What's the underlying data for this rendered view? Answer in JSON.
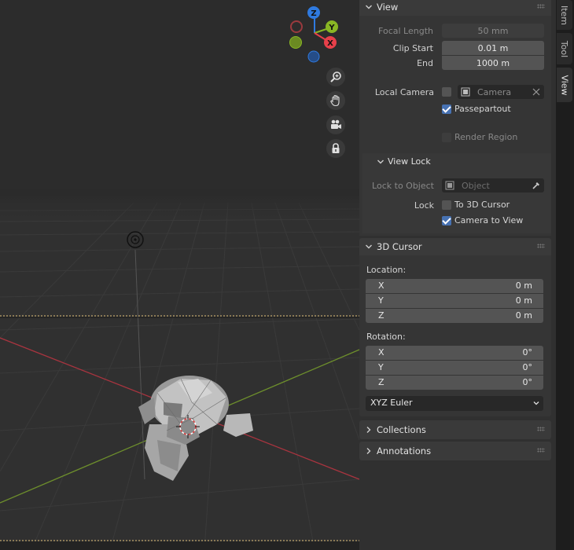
{
  "view_panel": {
    "title": "View",
    "focal_length_label": "Focal Length",
    "focal_length_value": "50 mm",
    "clip_start_label": "Clip Start",
    "clip_start_value": "0.01 m",
    "clip_end_label": "End",
    "clip_end_value": "1000 m",
    "local_camera_label": "Local Camera",
    "local_camera_placeholder": "Camera",
    "passepartout_label": "Passepartout",
    "passepartout_checked": true,
    "render_region_label": "Render Region",
    "render_region_checked": false
  },
  "view_lock": {
    "title": "View Lock",
    "lock_to_object_label": "Lock to Object",
    "lock_to_object_placeholder": "Object",
    "lock_label": "Lock",
    "to_3d_cursor_label": "To 3D Cursor",
    "to_3d_cursor_checked": false,
    "camera_to_view_label": "Camera to View",
    "camera_to_view_checked": true
  },
  "cursor_panel": {
    "title": "3D Cursor",
    "location_label": "Location:",
    "location": [
      {
        "axis": "X",
        "value": "0 m"
      },
      {
        "axis": "Y",
        "value": "0 m"
      },
      {
        "axis": "Z",
        "value": "0 m"
      }
    ],
    "rotation_label": "Rotation:",
    "rotation": [
      {
        "axis": "X",
        "value": "0°"
      },
      {
        "axis": "Y",
        "value": "0°"
      },
      {
        "axis": "Z",
        "value": "0°"
      }
    ],
    "rotation_mode": "XYZ Euler"
  },
  "collapsed_panels": [
    "Collections",
    "Annotations"
  ],
  "tabs": [
    "Item",
    "Tool",
    "View"
  ],
  "active_tab": "View",
  "gizmo": {
    "z_label": "Z",
    "y_label": "Y",
    "x_label": "X"
  },
  "viewport_tools": [
    "zoom-icon",
    "hand-pan-icon",
    "camera-view-icon",
    "lock-icon"
  ],
  "colors": {
    "accent": "#4772b3",
    "x_axis": "#e7404a",
    "y_axis": "#89b624",
    "z_axis": "#2f7ae0"
  }
}
